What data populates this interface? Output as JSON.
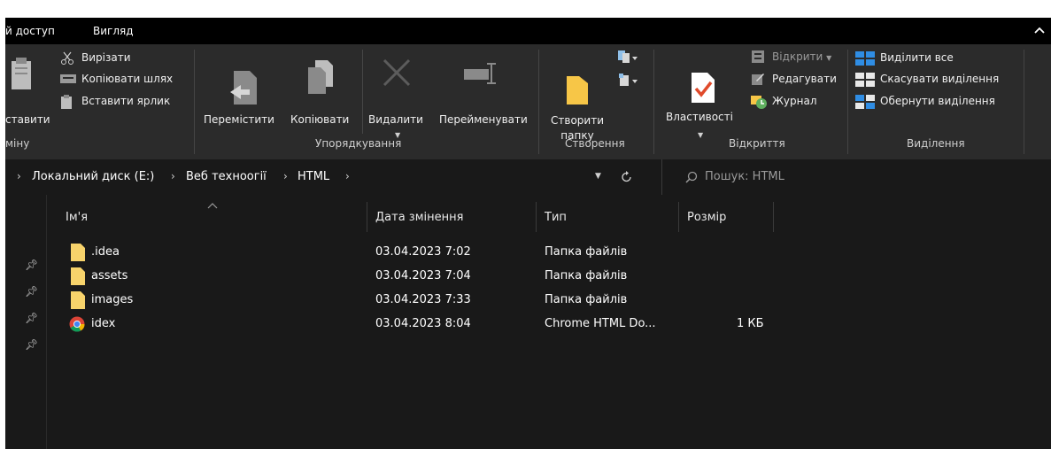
{
  "tabs": {
    "share": "й доступ",
    "view": "Вигляд"
  },
  "clipboard": {
    "cut": "Вирізати",
    "copy_path": "Копіювати шлях",
    "paste": "ставити",
    "paste_shortcut": "Вставити ярлик",
    "group_label": "міну"
  },
  "organize": {
    "move_to": "Перемістити",
    "copy_to": "Копіювати",
    "delete": "Видалити",
    "rename": "Перейменувати",
    "group_label": "Упорядкування"
  },
  "new": {
    "new_folder_line1": "Створити",
    "new_folder_line2": "папку",
    "group_label": "Створення"
  },
  "open": {
    "properties": "Властивості",
    "open": "Відкрити",
    "edit": "Редагувати",
    "history": "Журнал",
    "group_label": "Відкриття"
  },
  "select": {
    "select_all": "Виділити все",
    "select_none": "Скасувати виділення",
    "invert": "Обернути виділення",
    "group_label": "Виділення"
  },
  "address": {
    "crumbs": [
      "Локальний диск (E:)",
      "Веб техноогії",
      "HTML"
    ]
  },
  "search": {
    "placeholder": "Пошук: HTML"
  },
  "columns": {
    "name": "Ім'я",
    "date": "Дата змінення",
    "type": "Тип",
    "size": "Розмір"
  },
  "files": [
    {
      "name": ".idea",
      "date": "03.04.2023 7:02",
      "type": "Папка файлів",
      "size": "",
      "icon": "folder-icon"
    },
    {
      "name": "assets",
      "date": "03.04.2023 7:04",
      "type": "Папка файлів",
      "size": "",
      "icon": "folder-icon"
    },
    {
      "name": "images",
      "date": "03.04.2023 7:33",
      "type": "Папка файлів",
      "size": "",
      "icon": "folder-icon"
    },
    {
      "name": "idex",
      "date": "03.04.2023 8:04",
      "type": "Chrome HTML Do...",
      "size": "1 КБ",
      "icon": "chrome-icon"
    }
  ],
  "colors": {
    "background": "#191919",
    "ribbon": "#2b2b2b",
    "folder": "#f7d36b",
    "select_blue": "#2f8de4"
  }
}
